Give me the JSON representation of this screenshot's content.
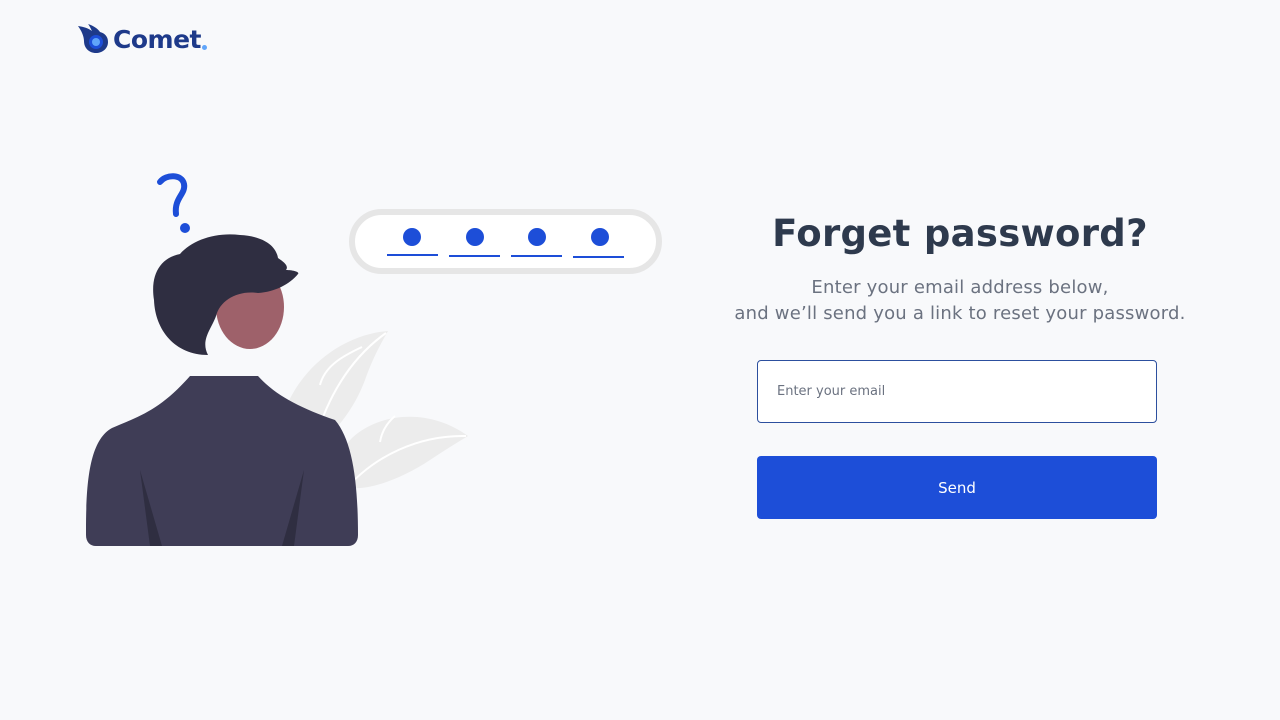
{
  "brand": {
    "name": "Comet",
    "primary_color": "#1e3a8a",
    "accent_color": "#60a5fa",
    "icon": "comet-flame-icon"
  },
  "illustration": {
    "description_icon": "confused-person-password-illustration",
    "password_dots": 4,
    "accent_color": "#1d4ed8"
  },
  "form": {
    "title": "Forget password?",
    "subtitle_line1": "Enter your email address below,",
    "subtitle_line2": "and we’ll send you a link to reset your password.",
    "email_placeholder": "Enter your email",
    "email_value": "",
    "send_label": "Send",
    "button_color": "#1d4ed8"
  }
}
